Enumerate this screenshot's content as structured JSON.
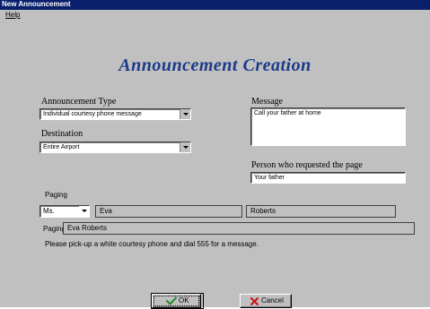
{
  "window": {
    "title": "New Announcement"
  },
  "menu": {
    "help": "Help"
  },
  "heading": "Announcement  Creation",
  "announcement_type": {
    "label": "Announcement Type",
    "value": "Individual courtesy phone message"
  },
  "destination": {
    "label": "Destination",
    "value": "Entire Airport"
  },
  "message": {
    "label": "Message",
    "value": "Call your father at home"
  },
  "requester": {
    "label": "Person who requested the page",
    "value": "Your father"
  },
  "paging": {
    "label": "Paging",
    "title_value": "Ms.",
    "first_name": "Eva",
    "last_name": "Roberts",
    "full_label": "Paging",
    "full_name": "Eva Roberts"
  },
  "instruction": "Please pick-up a white courtesy phone and dial 555 for a message.",
  "buttons": {
    "ok": "OK",
    "cancel": "Cancel"
  },
  "colors": {
    "title_bar": "#0a1f6b",
    "heading": "#1a3a8a",
    "ok_check": "#2e8b2e",
    "cancel_x": "#cc1111"
  },
  "icons": {
    "ok": "checkmark-icon",
    "cancel": "x-icon",
    "dropdown": "chevron-down-icon"
  }
}
